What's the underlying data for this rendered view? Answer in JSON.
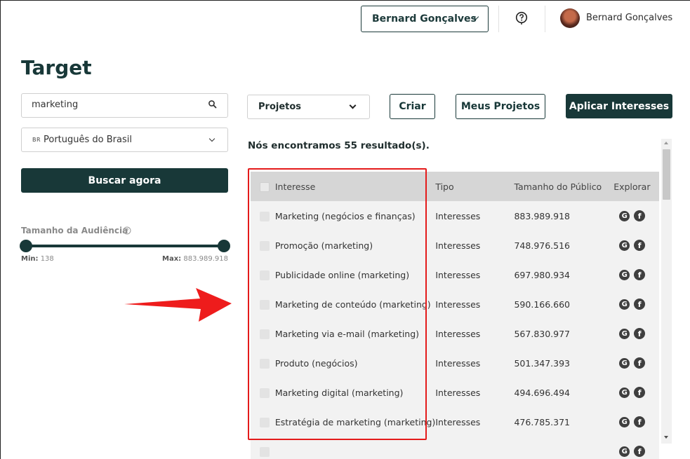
{
  "header": {
    "account_selector": "Bernard Gonçalves",
    "user_name": "Bernard Gonçalves"
  },
  "page": {
    "title": "Target"
  },
  "sidebar": {
    "search_value": "marketing",
    "language_flag": "BR",
    "language": "Português do Brasil",
    "search_button": "Buscar agora",
    "audience": {
      "label": "Tamanho da Audiência",
      "min_label": "Min:",
      "min_value": "138",
      "max_label": "Max:",
      "max_value": "883.989.918"
    }
  },
  "toolbar": {
    "projects_select": "Projetos",
    "create_button": "Criar",
    "my_projects_button": "Meus Projetos",
    "apply_button": "Aplicar Interesses"
  },
  "results": {
    "summary": "Nós encontramos 55 resultado(s).",
    "columns": [
      "Interesse",
      "Tipo",
      "Tamanho do Público",
      "Explorar"
    ],
    "rows": [
      {
        "interest": "Marketing (negócios e finanças)",
        "type": "Interesses",
        "size": "883.989.918"
      },
      {
        "interest": "Promoção (marketing)",
        "type": "Interesses",
        "size": "748.976.516"
      },
      {
        "interest": "Publicidade online (marketing)",
        "type": "Interesses",
        "size": "697.980.934"
      },
      {
        "interest": "Marketing de conteúdo (marketing)",
        "type": "Interesses",
        "size": "590.166.660"
      },
      {
        "interest": "Marketing via e-mail (marketing)",
        "type": "Interesses",
        "size": "567.830.977"
      },
      {
        "interest": "Produto (negócios)",
        "type": "Interesses",
        "size": "501.347.393"
      },
      {
        "interest": "Marketing digital (marketing)",
        "type": "Interesses",
        "size": "494.696.494"
      },
      {
        "interest": "Estratégia de marketing (marketing)",
        "type": "Interesses",
        "size": "476.785.371"
      },
      {
        "interest": "",
        "type": "",
        "size": ""
      }
    ],
    "explore_icons": {
      "google": "G",
      "facebook": "f"
    }
  },
  "colors": {
    "primary": "#183838",
    "highlight": "#e41b1b",
    "header_row": "#d6d6d6",
    "row_bg": "#f2f2f2"
  }
}
